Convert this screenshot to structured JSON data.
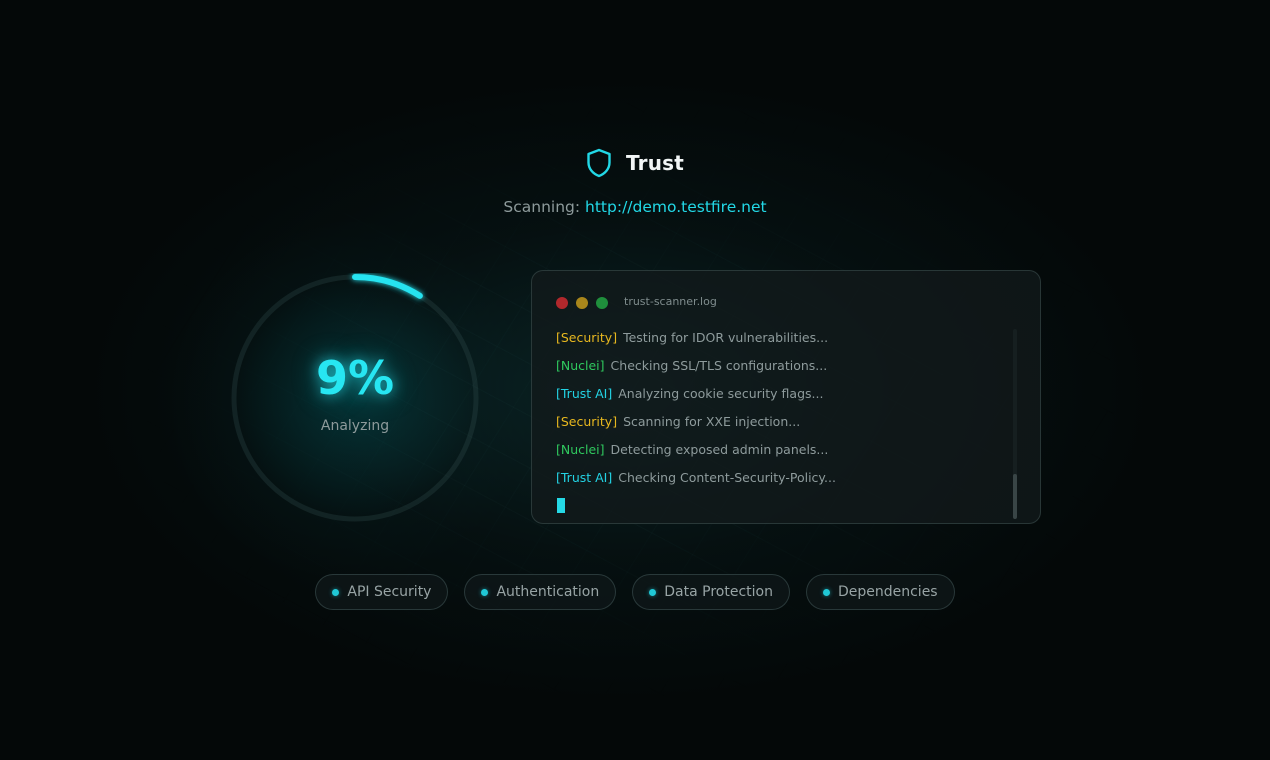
{
  "brand": {
    "name": "Trust",
    "icon": "shield-icon"
  },
  "scan": {
    "label": "Scanning:",
    "url": "http://demo.testfire.net"
  },
  "progress": {
    "percent_text": "9%",
    "percent": 9,
    "status": "Analyzing"
  },
  "terminal": {
    "title": "trust-scanner.log",
    "lines": [
      {
        "tag": "[Security]",
        "message": "Testing for IDOR vulnerabilities...",
        "tag_color": "#e8b81f"
      },
      {
        "tag": "[Nuclei]",
        "message": "Checking SSL/TLS configurations...",
        "tag_color": "#2fc85e"
      },
      {
        "tag": "[Trust AI]",
        "message": "Analyzing cookie security flags...",
        "tag_color": "#23d3e4"
      },
      {
        "tag": "[Security]",
        "message": "Scanning for XXE injection...",
        "tag_color": "#e8b81f"
      },
      {
        "tag": "[Nuclei]",
        "message": "Detecting exposed admin panels...",
        "tag_color": "#2fc85e"
      },
      {
        "tag": "[Trust AI]",
        "message": "Checking Content-Security-Policy...",
        "tag_color": "#23d3e4"
      }
    ]
  },
  "categories": [
    "API Security",
    "Authentication",
    "Data Protection",
    "Dependencies"
  ],
  "colors": {
    "accent": "#22d8e6",
    "background": "#040808"
  }
}
